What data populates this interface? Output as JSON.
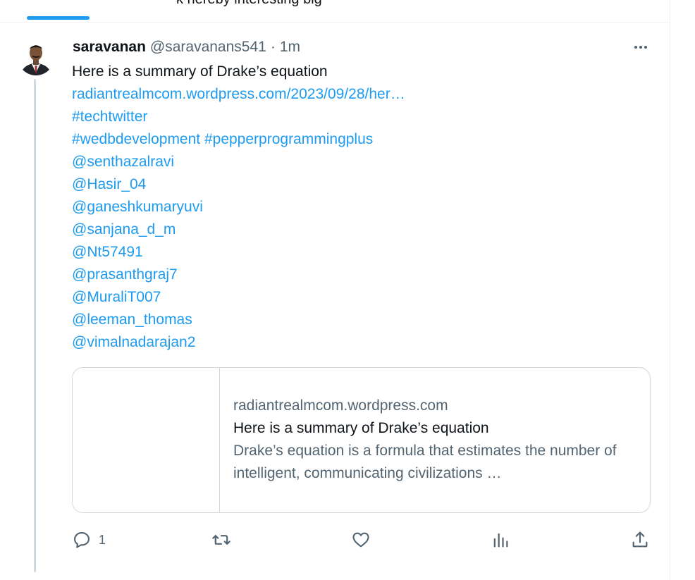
{
  "top": {
    "cut_text": "k hereby interesting big"
  },
  "tweet": {
    "display_name": "saravanan",
    "handle": "@saravanans541",
    "separator": "·",
    "time": "1m",
    "lines": [
      {
        "text": "Here is a summary of Drake’s equation",
        "kind": "plain"
      },
      {
        "text": "radiantrealmcom.wordpress.com/2023/09/28/her…",
        "kind": "link"
      },
      {
        "text": "#techtwitter",
        "kind": "link"
      },
      {
        "text": "#wedbdevelopment #pepperprogrammingplus",
        "kind": "link"
      },
      {
        "text": " @senthazalravi",
        "kind": "link"
      },
      {
        "text": "@Hasir_04",
        "kind": "link"
      },
      {
        "text": "@ganeshkumaryuvi",
        "kind": "link"
      },
      {
        "text": "@sanjana_d_m",
        "kind": "link"
      },
      {
        "text": "@Nt57491",
        "kind": "link"
      },
      {
        "text": "@prasanthgraj7",
        "kind": "link"
      },
      {
        "text": "@MuraliT007",
        "kind": "link"
      },
      {
        "text": "@leeman_thomas",
        "kind": "link"
      },
      {
        "text": "@vimalnadarajan2",
        "kind": "link"
      }
    ],
    "card": {
      "domain": "radiantrealmcom.wordpress.com",
      "title": "Here is a summary of Drake’s equation",
      "description": "Drake’s equation is a formula that estimates the number of intelligent, communicating civilizations …"
    },
    "actions": {
      "reply_count": "1"
    }
  },
  "icons": {
    "more": "more-dots-icon",
    "reply": "reply-icon",
    "repost": "repost-icon",
    "like": "like-icon",
    "views": "views-icon",
    "share": "share-icon"
  },
  "colors": {
    "link": "#1d9bf0",
    "text": "#0f1419",
    "secondary": "#536471",
    "border": "#cfd9de"
  }
}
